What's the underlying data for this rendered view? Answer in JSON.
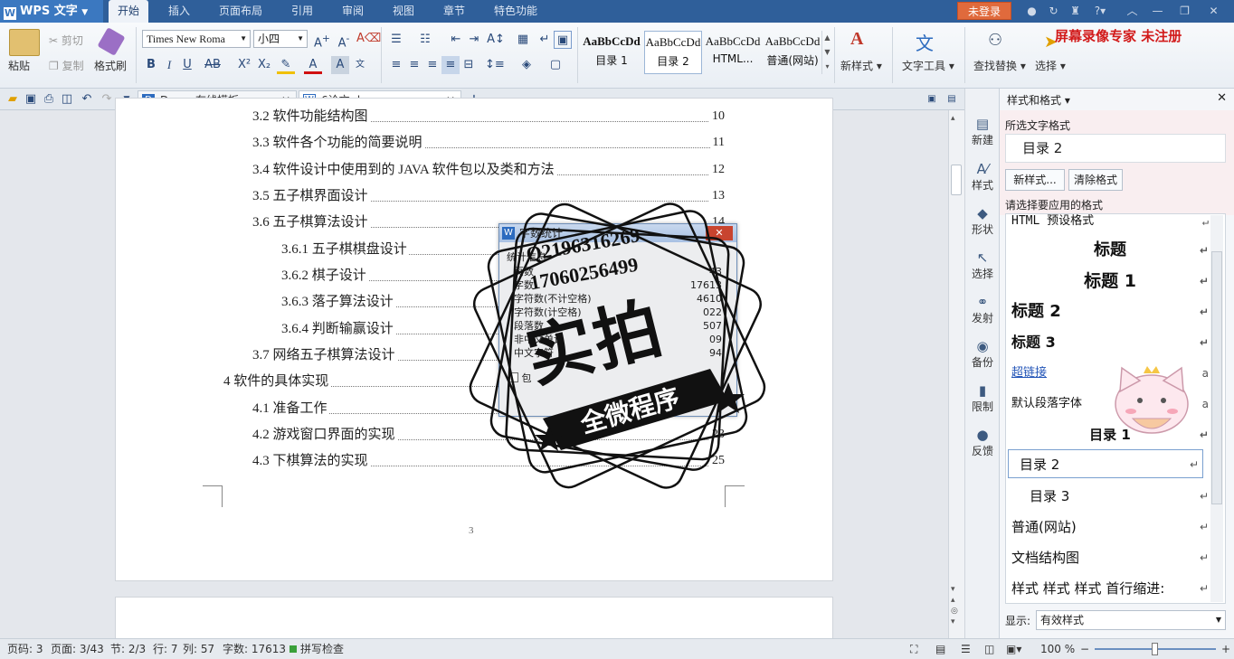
{
  "app": {
    "name": "WPS 文字",
    "tabs": [
      "开始",
      "插入",
      "页面布局",
      "引用",
      "审阅",
      "视图",
      "章节",
      "特色功能"
    ],
    "active_tab": "开始",
    "login_label": "未登录",
    "watermark_text": "屏幕录像专家  未注册"
  },
  "ribbon": {
    "clipboard": {
      "paste": "粘贴",
      "cut": "剪切",
      "copy": "复制",
      "format_painter": "格式刷"
    },
    "font_name": "Times New Roma",
    "font_size": "小四",
    "styles": [
      {
        "preview": "AaBbCcDd",
        "label": "目录 1"
      },
      {
        "preview": "AaBbCcDd",
        "label": "目录 2"
      },
      {
        "preview": "AaBbCcDd",
        "label": "HTML..."
      },
      {
        "preview": "AaBbCcDd",
        "label": "普通(网站)"
      }
    ],
    "new_style": "新样式",
    "text_tools": "文字工具",
    "find_replace": "查找替换",
    "select": "选择"
  },
  "doc_tabs": [
    {
      "label": "Docer-在线模板"
    },
    {
      "label": "6论文.doc"
    }
  ],
  "toc": [
    {
      "text": "3.2 软件功能结构图",
      "page": "10"
    },
    {
      "text": "3.3 软件各个功能的简要说明",
      "page": "11"
    },
    {
      "text": "3.4 软件设计中使用到的 JAVA 软件包以及类和方法",
      "page": "12"
    },
    {
      "text": "3.5  五子棋界面设计",
      "page": "13"
    },
    {
      "text": "3.6  五子棋算法设计",
      "page": "14"
    },
    {
      "text": "3.6.1  五子棋棋盘设计",
      "page": ""
    },
    {
      "text": "3.6.2  棋子设计",
      "page": ""
    },
    {
      "text": "3.6.3  落子算法设计",
      "page": ""
    },
    {
      "text": "3.6.4  判断输赢设计",
      "page": ""
    },
    {
      "text": "3.7  网络五子棋算法设计",
      "page": ""
    },
    {
      "text": "4   软件的具体实现",
      "page": ""
    },
    {
      "text": "4.1 准备工作",
      "page": ""
    },
    {
      "text": "4.2 游戏窗口界面的实现",
      "page": "23"
    },
    {
      "text": "4.3 下棋算法的实现",
      "page": "25"
    }
  ],
  "page_number": "3",
  "dialog": {
    "title": "字数统计",
    "section": "统计信息",
    "rows": [
      {
        "label": "页数",
        "value": "43"
      },
      {
        "label": "字数",
        "value": "17613"
      },
      {
        "label": "字符数(不计空格)",
        "value": "4610"
      },
      {
        "label": "字符数(计空格)",
        "value": "022"
      },
      {
        "label": "段落数",
        "value": "507"
      },
      {
        "label": "非中文单词",
        "value": "09"
      },
      {
        "label": "中文字符",
        "value": "94"
      }
    ],
    "checkbox_label": "包"
  },
  "stamp": {
    "qq": "Q2196316269",
    "phone": "17060256499",
    "main": "实拍",
    "banner": "全微程序"
  },
  "side_tools": [
    "新建",
    "样式",
    "形状",
    "选择",
    "发射",
    "备份",
    "限制",
    "反馈"
  ],
  "pane": {
    "title": "样式和格式",
    "selected_label": "所选文字格式",
    "selected_value": "目录 2",
    "new_style_btn": "新样式...",
    "clear_btn": "清除格式",
    "apply_label": "请选择要应用的格式",
    "styles": [
      "HTML 预设格式",
      "标题",
      "标题 1",
      "标题 2",
      "标题 3",
      "超链接",
      "默认段落字体",
      "目录 1",
      "目录 2",
      "目录 3",
      "普通(网站)",
      "文档结构图",
      "样式 样式 样式 首行缩进:"
    ],
    "show_label": "显示:",
    "show_value": "有效样式"
  },
  "status": {
    "page_code": "页码: 3",
    "pages": "页面: 3/43",
    "section": "节: 2/3",
    "row": "行: 7",
    "col": "列: 57",
    "words": "字数: 17613",
    "spell": "拼写检查",
    "zoom": "100 %"
  },
  "colors": {
    "titlebar": "#2f5f9a",
    "accent": "#3b78c0",
    "login": "#e06a3c",
    "watermark": "#d21a1a"
  }
}
